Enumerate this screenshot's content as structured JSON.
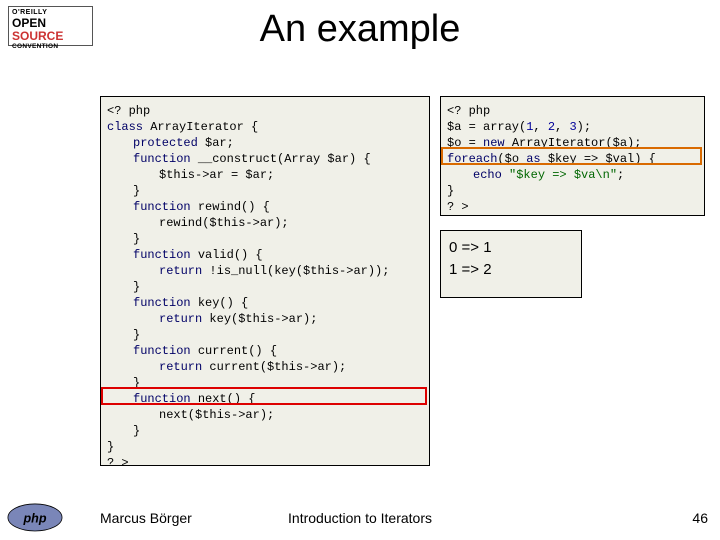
{
  "slide": {
    "title": "An example",
    "author": "Marcus Börger",
    "footerTitle": "Introduction to Iterators",
    "pageNumber": "46"
  },
  "topLogo": {
    "line1": "O'REILLY",
    "line2a": "OPEN",
    "line2b": "SOURCE",
    "line3": "CONVENTION"
  },
  "codeLeft": {
    "l1": "<? php",
    "l2a": "class ",
    "l2b": "ArrayIterator {",
    "l3a": "protected ",
    "l3b": "$ar;",
    "l4a": "function ",
    "l4b": "__construct(Array $ar) {",
    "l5": "$this->ar = $ar;",
    "l6": "}",
    "l7a": "function ",
    "l7b": "rewind() {",
    "l8": "rewind($this->ar);",
    "l9": "}",
    "l10a": "function ",
    "l10b": "valid() {",
    "l11a": "return ",
    "l11b": "!is_null(key($this->ar));",
    "l12": "}",
    "l13a": "function ",
    "l13b": "key() {",
    "l14a": "return ",
    "l14b": "key($this->ar);",
    "l15": "}",
    "l16a": "function ",
    "l16b": "current() {",
    "l17a": "return ",
    "l17b": "current($this->ar);",
    "l18": "}",
    "l19a": "function ",
    "l19b": "next() {",
    "l20": "next($this->ar);",
    "l21": "}",
    "l22": "}",
    "l23": "? >"
  },
  "codeRight": {
    "l1": "<? php",
    "l2a": "$a = array(",
    "l2b": "1",
    "l2c": ", ",
    "l2d": "2",
    "l2e": ", ",
    "l2f": "3",
    "l2g": ");",
    "l3a": "$o = ",
    "l3b": "new ",
    "l3c": "ArrayIterator($a);",
    "l4a": "foreach",
    "l4b": "($o ",
    "l4c": "as ",
    "l4d": "$key => $val) {",
    "l5a": "echo ",
    "l5b": "\"$key => $va\\n\"",
    "l5c": ";",
    "l6": "}",
    "l7": "? >"
  },
  "output": {
    "l1": "0 => 1",
    "l2": "1 => 2"
  }
}
